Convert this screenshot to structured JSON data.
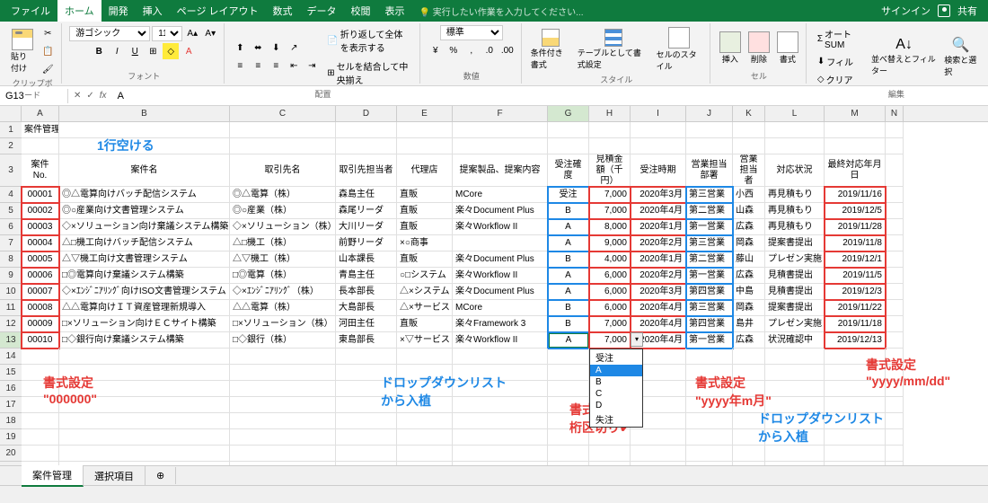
{
  "titlebar": {
    "tabs": [
      "ファイル",
      "ホーム",
      "開発",
      "挿入",
      "ページ レイアウト",
      "数式",
      "データ",
      "校閲",
      "表示"
    ],
    "active_tab": 1,
    "tell_me": "実行したい作業を入力してください...",
    "signin": "サインイン",
    "share": "共有"
  },
  "ribbon": {
    "clipboard": {
      "label": "クリップボード",
      "paste": "貼り付け"
    },
    "font": {
      "label": "フォント",
      "family": "游ゴシック",
      "size": "11",
      "bold": "B",
      "italic": "I",
      "underline": "U"
    },
    "align": {
      "label": "配置",
      "wrap": "折り返して全体を表示する",
      "merge": "セルを結合して中央揃え"
    },
    "number": {
      "label": "数値",
      "format": "標準"
    },
    "styles": {
      "label": "スタイル",
      "cond": "条件付き書式",
      "table": "テーブルとして書式設定",
      "cell": "セルのスタイル"
    },
    "cells": {
      "label": "セル",
      "insert": "挿入",
      "delete": "削除",
      "format": "書式"
    },
    "editing": {
      "label": "編集",
      "autosum": "オート SUM",
      "fill": "フィル",
      "clear": "クリア",
      "sort": "並べ替えとフィルター",
      "find": "検索と選択"
    }
  },
  "namebox": "G13",
  "formula": "A",
  "columns": [
    "A",
    "B",
    "C",
    "D",
    "E",
    "F",
    "G",
    "H",
    "I",
    "J",
    "K",
    "L",
    "M",
    "N"
  ],
  "title_cell": "案件管理",
  "headers": [
    "案件No.",
    "案件名",
    "取引先名",
    "取引先担当者",
    "代理店",
    "提案製品、提案内容",
    "受注確度",
    "見積金額（千円）",
    "受注時期",
    "営業担当部署",
    "営業担当者",
    "対応状況",
    "最終対応年月日"
  ],
  "rows": [
    {
      "no": "00001",
      "name": "◎△電算向けバッチ配信システム",
      "cust": "◎△電算（株）",
      "contact": "森島主任",
      "agent": "直販",
      "prod": "MCore",
      "prob": "受注",
      "amt": "7,000",
      "when": "2020年3月",
      "dept": "第三営業",
      "rep": "小西",
      "status": "再見積もり",
      "date": "2019/11/16"
    },
    {
      "no": "00002",
      "name": "◎○産業向け文書管理システム",
      "cust": "◎○産業（株）",
      "contact": "森尾リーダ",
      "agent": "直販",
      "prod": "楽々Document Plus",
      "prob": "B",
      "amt": "7,000",
      "when": "2020年4月",
      "dept": "第二営業",
      "rep": "山森",
      "status": "再見積もり",
      "date": "2019/12/5"
    },
    {
      "no": "00003",
      "name": "◇×ソリューション向け棄議システム構築",
      "cust": "◇×ソリューション（株）",
      "contact": "大川リーダ",
      "agent": "直販",
      "prod": "楽々Workflow II",
      "prob": "A",
      "amt": "8,000",
      "when": "2020年1月",
      "dept": "第一営業",
      "rep": "広森",
      "status": "再見積もり",
      "date": "2019/11/28"
    },
    {
      "no": "00004",
      "name": "△□機工向けバッチ配信システム",
      "cust": "△□機工（株）",
      "contact": "前野リーダ",
      "agent": "×○商事",
      "prod": "",
      "prob": "A",
      "amt": "9,000",
      "when": "2020年2月",
      "dept": "第三営業",
      "rep": "岡森",
      "status": "提案書提出",
      "date": "2019/11/8"
    },
    {
      "no": "00005",
      "name": "△▽機工向け文書管理システム",
      "cust": "△▽機工（株）",
      "contact": "山本課長",
      "agent": "直販",
      "prod": "楽々Document Plus",
      "prob": "B",
      "amt": "4,000",
      "when": "2020年1月",
      "dept": "第二営業",
      "rep": "藤山",
      "status": "プレゼン実施",
      "date": "2019/12/1"
    },
    {
      "no": "00006",
      "name": "□◎電算向け棄議システム構築",
      "cust": "□◎電算（株）",
      "contact": "青島主任",
      "agent": "○□システム",
      "prod": "楽々Workflow II",
      "prob": "A",
      "amt": "6,000",
      "when": "2020年2月",
      "dept": "第一営業",
      "rep": "広森",
      "status": "見積書提出",
      "date": "2019/11/5"
    },
    {
      "no": "00007",
      "name": "◇×ｴﾝｼﾞﾆｱﾘﾝｸﾞ向けISO文書管理システム",
      "cust": "◇×ｴﾝｼﾞﾆｱﾘﾝｸﾞ（株）",
      "contact": "長本部長",
      "agent": "△×システム",
      "prod": "楽々Document Plus",
      "prob": "A",
      "amt": "6,000",
      "when": "2020年3月",
      "dept": "第四営業",
      "rep": "中島",
      "status": "見積書提出",
      "date": "2019/12/3"
    },
    {
      "no": "00008",
      "name": "△△電算向けＩＴ資産管理新規導入",
      "cust": "△△電算（株）",
      "contact": "大島部長",
      "agent": "△×サービス",
      "prod": "MCore",
      "prob": "B",
      "amt": "6,000",
      "when": "2020年4月",
      "dept": "第三営業",
      "rep": "岡森",
      "status": "提案書提出",
      "date": "2019/11/22"
    },
    {
      "no": "00009",
      "name": "□×ソリューション向けＥＣサイト構築",
      "cust": "□×ソリューション（株）",
      "contact": "河田主任",
      "agent": "直販",
      "prod": "楽々Framework 3",
      "prob": "B",
      "amt": "7,000",
      "when": "2020年4月",
      "dept": "第四営業",
      "rep": "島井",
      "status": "プレゼン実施",
      "date": "2019/11/18"
    },
    {
      "no": "00010",
      "name": "□◇銀行向け棄議システム構築",
      "cust": "□◇銀行（株）",
      "contact": "東島部長",
      "agent": "×▽サービス",
      "prod": "楽々Workflow II",
      "prob": "A",
      "amt": "7,000",
      "when": "2020年4月",
      "dept": "第一営業",
      "rep": "広森",
      "status": "状況確認中",
      "date": "2019/12/13"
    }
  ],
  "dropdown": {
    "items": [
      "受注",
      "A",
      "B",
      "C",
      "D",
      "失注"
    ],
    "highlighted": 1
  },
  "annotations": {
    "blank_row": "1行空ける",
    "fmt_000000_1": "書式設定",
    "fmt_000000_2": "\"000000\"",
    "dd_from_1": "ドロップダウンリスト",
    "dd_from_2": "から入植",
    "fmt_sep_1": "書式設定",
    "fmt_sep_2": "桁区切り✔",
    "fmt_ym_1": "書式設定",
    "fmt_ym_2": "\"yyyy年m月\"",
    "dd_from2_1": "ドロップダウンリスト",
    "dd_from2_2": "から入植",
    "fmt_ymd_1": "書式設定",
    "fmt_ymd_2": "\"yyyy/mm/dd\""
  },
  "sheets": [
    "案件管理",
    "選択項目"
  ],
  "active_sheet": 0
}
